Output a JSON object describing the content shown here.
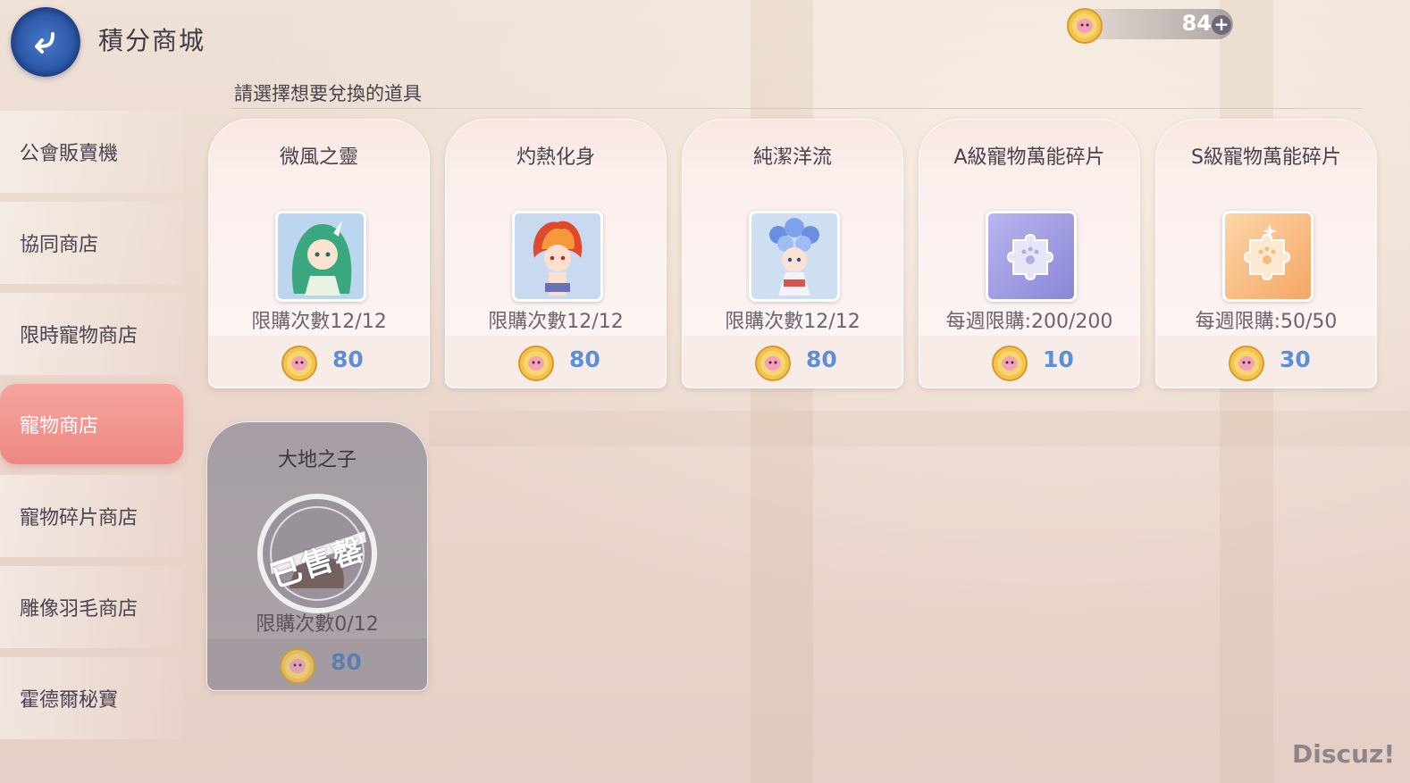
{
  "header": {
    "title": "積分商城",
    "currency_value": "84",
    "currency_plus": "+"
  },
  "sidebar": {
    "items": [
      {
        "label": "公會販賣機",
        "active": false
      },
      {
        "label": "協同商店",
        "active": false
      },
      {
        "label": "限時寵物商店",
        "active": false
      },
      {
        "label": "寵物商店",
        "active": true
      },
      {
        "label": "寵物碎片商店",
        "active": false
      },
      {
        "label": "雕像羽毛商店",
        "active": false
      },
      {
        "label": "霍德爾秘寶",
        "active": false
      }
    ]
  },
  "main": {
    "subtitle": "請選擇想要兌換的道具",
    "items": [
      {
        "name": "微風之靈",
        "limit": "限購次數12/12",
        "price": "80",
        "icon": "green-haired-spirit-icon",
        "sold_out": false
      },
      {
        "name": "灼熱化身",
        "limit": "限購次數12/12",
        "price": "80",
        "icon": "fire-haired-spirit-icon",
        "sold_out": false
      },
      {
        "name": "純潔洋流",
        "limit": "限購次數12/12",
        "price": "80",
        "icon": "bubble-haired-spirit-icon",
        "sold_out": false
      },
      {
        "name": "A級寵物萬能碎片",
        "limit": "每週限購:200/200",
        "price": "10",
        "icon": "purple-puzzle-piece-icon",
        "sold_out": false
      },
      {
        "name": "S級寵物萬能碎片",
        "limit": "每週限購:50/50",
        "price": "30",
        "icon": "orange-puzzle-piece-icon",
        "sold_out": false
      },
      {
        "name": "大地之子",
        "limit": "限購次數0/12",
        "price": "80",
        "icon": "earth-child-icon",
        "sold_out": true,
        "sold_out_label": "已售罄"
      }
    ]
  },
  "watermark": "Discuz!",
  "colors": {
    "accent_active": "#f49a96",
    "price_blue": "#5d8fd6",
    "card_bg": "#fbefec"
  }
}
